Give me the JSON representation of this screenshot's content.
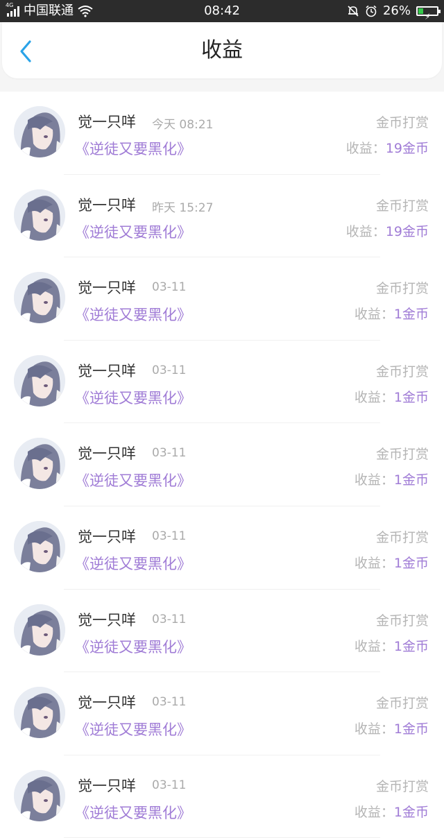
{
  "status_bar": {
    "network": "4G",
    "carrier": "中国联通",
    "time": "08:42",
    "battery": "26%",
    "battery_level": 0.26,
    "colors": {
      "background": "#2c2c2c",
      "battery_fill": "#35c94a"
    }
  },
  "header": {
    "title": "收益",
    "back_icon": "chevron-left-icon",
    "accent": "#2aa3e8"
  },
  "colors": {
    "purple": "#a07cd6",
    "gray": "#b5b5b5"
  },
  "items": [
    {
      "name": "觉一只咩",
      "time": "今天 08:21",
      "book": "《逆徒又要黑化》",
      "type": "金币打赏",
      "earn_label": "收益：",
      "earn_value": "19金币"
    },
    {
      "name": "觉一只咩",
      "time": "昨天 15:27",
      "book": "《逆徒又要黑化》",
      "type": "金币打赏",
      "earn_label": "收益：",
      "earn_value": "19金币"
    },
    {
      "name": "觉一只咩",
      "time": "03-11",
      "book": "《逆徒又要黑化》",
      "type": "金币打赏",
      "earn_label": "收益：",
      "earn_value": "1金币"
    },
    {
      "name": "觉一只咩",
      "time": "03-11",
      "book": "《逆徒又要黑化》",
      "type": "金币打赏",
      "earn_label": "收益：",
      "earn_value": "1金币"
    },
    {
      "name": "觉一只咩",
      "time": "03-11",
      "book": "《逆徒又要黑化》",
      "type": "金币打赏",
      "earn_label": "收益：",
      "earn_value": "1金币"
    },
    {
      "name": "觉一只咩",
      "time": "03-11",
      "book": "《逆徒又要黑化》",
      "type": "金币打赏",
      "earn_label": "收益：",
      "earn_value": "1金币"
    },
    {
      "name": "觉一只咩",
      "time": "03-11",
      "book": "《逆徒又要黑化》",
      "type": "金币打赏",
      "earn_label": "收益：",
      "earn_value": "1金币"
    },
    {
      "name": "觉一只咩",
      "time": "03-11",
      "book": "《逆徒又要黑化》",
      "type": "金币打赏",
      "earn_label": "收益：",
      "earn_value": "1金币"
    },
    {
      "name": "觉一只咩",
      "time": "03-11",
      "book": "《逆徒又要黑化》",
      "type": "金币打赏",
      "earn_label": "收益：",
      "earn_value": "1金币"
    }
  ]
}
